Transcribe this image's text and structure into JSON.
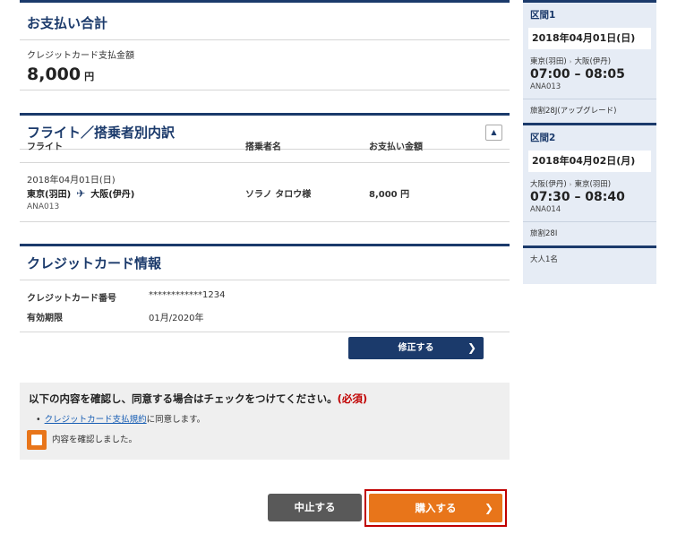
{
  "payment": {
    "title": "お支払い合計",
    "label": "クレジットカード支払金額",
    "amount": "8,000",
    "currency": "円"
  },
  "breakdown": {
    "title": "フライト／搭乗者別内訳",
    "collapse_icon": "▲",
    "headers": {
      "flight": "フライト",
      "passenger": "搭乗者名",
      "amount": "お支払い金額"
    },
    "row": {
      "date": "2018年04月01日(日)",
      "from": "東京(羽田)",
      "to": "大阪(伊丹)",
      "flight_no": "ANA013",
      "passenger": "ソラノ タロウ様",
      "amount": "8,000 円"
    }
  },
  "card": {
    "title": "クレジットカード情報",
    "number_label": "クレジットカード番号",
    "number_value": "************1234",
    "expiry_label": "有効期限",
    "expiry_value": "01月/2020年",
    "edit_label": "修正する"
  },
  "consent": {
    "title": "以下の内容を確認し、同意する場合はチェックをつけてください。",
    "required": "(必須)",
    "link_text": "クレジットカード支払規約",
    "link_suffix": "に同意します。",
    "check_label": "内容を確認しました。"
  },
  "actions": {
    "cancel_label": "中止する",
    "buy_label": "購入する"
  },
  "sidebar": {
    "legs": [
      {
        "title": "区間1",
        "date": "2018年04月01日(日)",
        "from": "東京(羽田)",
        "to": "大阪(伊丹)",
        "time": "07:00 – 08:05",
        "flight_no": "ANA013",
        "fare": "旅割28J(アップグレード)"
      },
      {
        "title": "区間2",
        "date": "2018年04月02日(月)",
        "from": "大阪(伊丹)",
        "to": "東京(羽田)",
        "time": "07:30 – 08:40",
        "flight_no": "ANA014",
        "fare": "旅割28I"
      }
    ],
    "pax_count": "大人1名"
  },
  "colors": {
    "navy": "#1b3a6b",
    "orange": "#e8751a",
    "required_red": "#c00000",
    "sidebar_bg": "#e6ecf5"
  }
}
